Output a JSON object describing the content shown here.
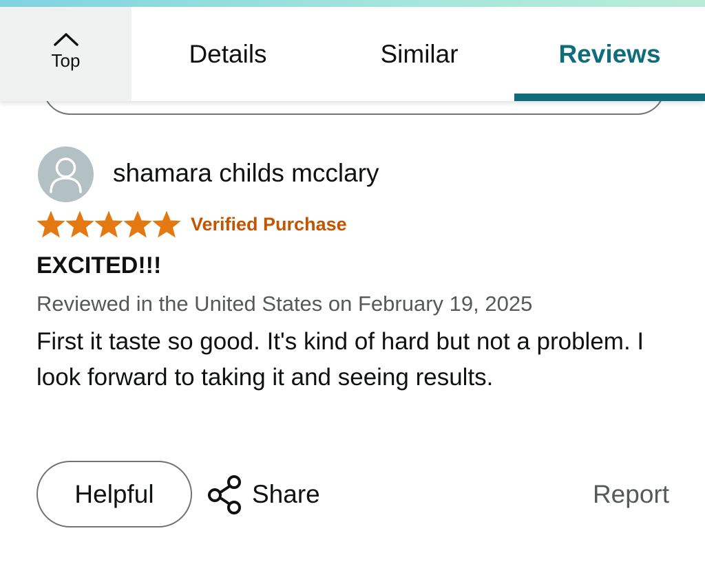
{
  "nav": {
    "top_label": "Top",
    "tabs": [
      "Details",
      "Similar",
      "Reviews"
    ],
    "active_tab": "Reviews",
    "active_color": "#0f6c7b"
  },
  "review": {
    "reviewer_name": "shamara childs mcclary",
    "rating": 5,
    "rating_max": 5,
    "star_color": "#e47911",
    "verified_label": "Verified Purchase",
    "title": "EXCITED!!!",
    "date_line": "Reviewed in the United States on February 19, 2025",
    "body": "First it taste so good. It's kind of hard but not a problem. I look forward to taking it and seeing results."
  },
  "actions": {
    "helpful_label": "Helpful",
    "share_label": "Share",
    "report_label": "Report"
  }
}
